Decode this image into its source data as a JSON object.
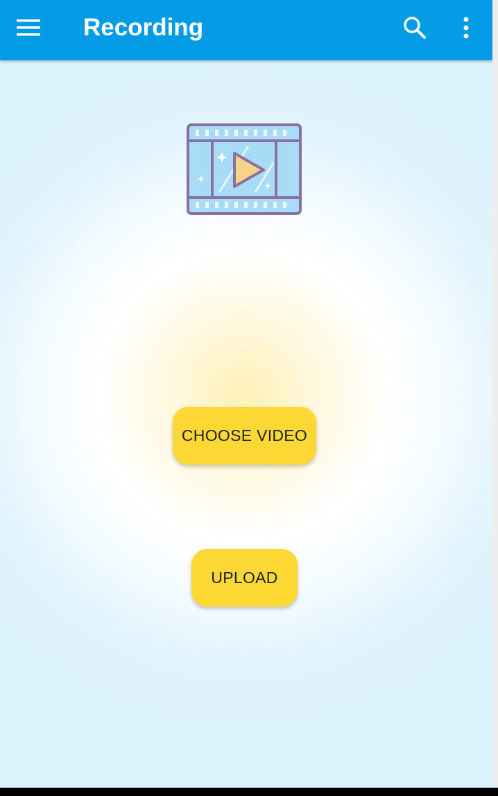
{
  "toolbar": {
    "title": "Recording",
    "menu_icon": "hamburger-menu-icon",
    "search_icon": "search-icon",
    "more_icon": "more-vert-icon",
    "color": "#039be5"
  },
  "main": {
    "hero_icon": "video-film-play-icon",
    "choose_video_label": "CHOOSE VIDEO",
    "upload_label": "UPLOAD",
    "button_color": "#fdd835"
  }
}
